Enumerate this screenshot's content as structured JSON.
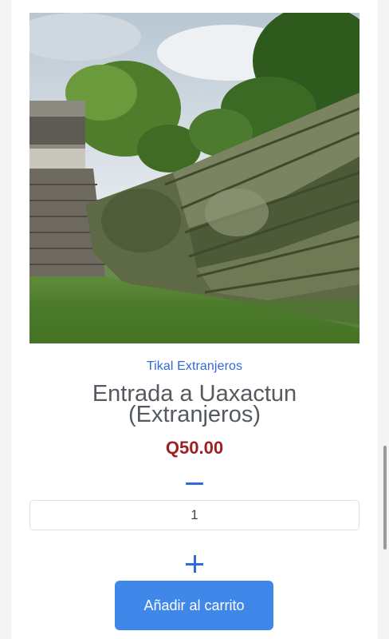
{
  "product": {
    "image_alt": "Entrada a Uaxactun (Extranjeros)",
    "category": "Tikal Extranjeros",
    "title": "Entrada a Uaxactun (Extranjeros)",
    "price": "Q50.00"
  },
  "quantity": {
    "value": "1",
    "decrease_icon": "minus-icon",
    "increase_icon": "plus-icon"
  },
  "actions": {
    "add_to_cart_label": "Añadir al carrito"
  },
  "colors": {
    "accent": "#2f6ad8",
    "button": "#3f87e8",
    "price": "#9e1f1f",
    "title": "#555a61"
  }
}
